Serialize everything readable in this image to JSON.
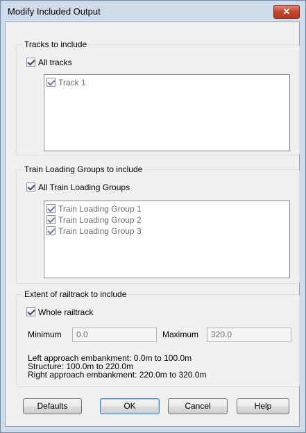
{
  "window": {
    "title": "Modify Included Output",
    "close_glyph": "✕"
  },
  "tracks": {
    "legend": "Tracks to include",
    "all_label": "All tracks",
    "all_checked": true,
    "items": [
      {
        "label": "Track 1",
        "checked": true
      }
    ]
  },
  "groups": {
    "legend": "Train Loading Groups to include",
    "all_label": "All Train Loading Groups",
    "all_checked": true,
    "items": [
      {
        "label": "Train Loading Group 1",
        "checked": true
      },
      {
        "label": "Train Loading Group 2",
        "checked": true
      },
      {
        "label": "Train Loading Group 3",
        "checked": true
      }
    ]
  },
  "extent": {
    "legend": "Extent of railtrack to include",
    "whole_label": "Whole railtrack",
    "whole_checked": true,
    "min_label": "Minimum",
    "min_value": "0.0",
    "max_label": "Maximum",
    "max_value": "320.0",
    "info": [
      "Left approach embankment: 0.0m to 100.0m",
      "Structure: 100.0m to 220.0m",
      "Right approach embankment: 220.0m to 320.0m"
    ]
  },
  "buttons": {
    "defaults": "Defaults",
    "ok": "OK",
    "cancel": "Cancel",
    "help": "Help"
  }
}
